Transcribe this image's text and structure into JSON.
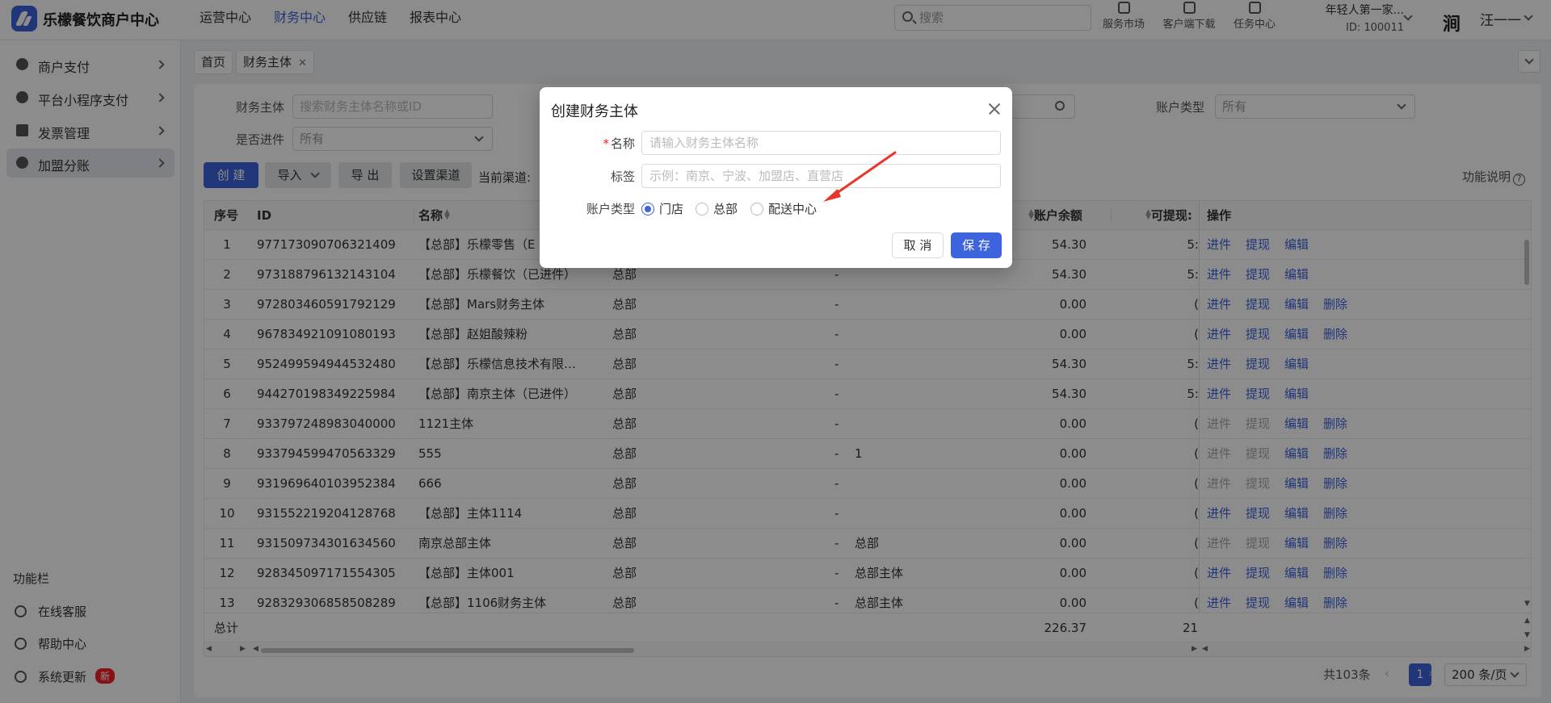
{
  "app": {
    "title": "乐檬餐饮商户中心"
  },
  "top_nav": [
    {
      "label": "运营中心",
      "active": false
    },
    {
      "label": "财务中心",
      "active": true
    },
    {
      "label": "供应链",
      "active": false
    },
    {
      "label": "报表中心",
      "active": false
    }
  ],
  "search": {
    "placeholder": "搜索"
  },
  "tools": [
    {
      "label": "服务市场",
      "icon": "store-icon"
    },
    {
      "label": "客户端下载",
      "icon": "download-icon"
    },
    {
      "label": "任务中心",
      "icon": "task-icon"
    }
  ],
  "tenant": {
    "name": "年轻人第一家...",
    "id": "ID: 100011"
  },
  "user": {
    "avatar_glyph": "涧",
    "name": "汪一一"
  },
  "sidebar": {
    "items": [
      {
        "label": "商户支付",
        "icon": "dollar-icon",
        "active": false
      },
      {
        "label": "平台小程序支付",
        "icon": "mini-program-icon",
        "active": false
      },
      {
        "label": "发票管理",
        "icon": "invoice-icon",
        "active": false
      },
      {
        "label": "加盟分账",
        "icon": "user-add-icon",
        "active": true
      }
    ],
    "func_title": "功能栏",
    "func_items": [
      {
        "label": "在线客服",
        "icon": "headset-icon"
      },
      {
        "label": "帮助中心",
        "icon": "help-icon"
      },
      {
        "label": "系统更新",
        "icon": "refresh-icon",
        "badge": "新"
      }
    ]
  },
  "tabs": [
    {
      "label": "首页",
      "closable": false
    },
    {
      "label": "财务主体",
      "closable": true
    }
  ],
  "filters": {
    "entity_label": "财务主体",
    "entity_placeholder": "搜索财务主体名称或ID",
    "account_type_label": "账户类型",
    "account_type_value": "所有",
    "incoming_label": "是否进件",
    "incoming_value": "所有"
  },
  "toolbar": {
    "create": "创 建",
    "import": "导入",
    "export": "导 出",
    "set_channel": "设置渠道",
    "current_channel": "当前渠道:",
    "help": "功能说明"
  },
  "table": {
    "headers": {
      "index": "序号",
      "id": "ID",
      "name": "名称",
      "balance": "账户余额",
      "withdrawable": "可提现:",
      "ops": "操作"
    },
    "rows": [
      {
        "idx": "1",
        "id": "977173090706321409",
        "name": "【总部】乐檬零售（E",
        "type": "",
        "dash": "",
        "tag": "",
        "balance": "54.30",
        "wd": "5:",
        "ops": [
          "进件",
          "提现",
          "编辑"
        ],
        "dis": [
          false,
          false,
          false
        ]
      },
      {
        "idx": "2",
        "id": "973188796132143104",
        "name": "【总部】乐檬餐饮（已进件）",
        "type": "总部",
        "dash": "-",
        "tag": "",
        "balance": "54.30",
        "wd": "5:",
        "ops": [
          "进件",
          "提现",
          "编辑"
        ],
        "dis": [
          false,
          false,
          false
        ]
      },
      {
        "idx": "3",
        "id": "972803460591792129",
        "name": "【总部】Mars财务主体",
        "type": "总部",
        "dash": "-",
        "tag": "",
        "balance": "0.00",
        "wd": "(",
        "ops": [
          "进件",
          "提现",
          "编辑",
          "删除"
        ],
        "dis": [
          false,
          false,
          false,
          false
        ]
      },
      {
        "idx": "4",
        "id": "967834921091080193",
        "name": "【总部】赵姐酸辣粉",
        "type": "总部",
        "dash": "-",
        "tag": "",
        "balance": "0.00",
        "wd": "(",
        "ops": [
          "进件",
          "提现",
          "编辑",
          "删除"
        ],
        "dis": [
          false,
          false,
          false,
          false
        ]
      },
      {
        "idx": "5",
        "id": "952499594944532480",
        "name": "【总部】乐檬信息技术有限…",
        "type": "总部",
        "dash": "-",
        "tag": "",
        "balance": "54.30",
        "wd": "5:",
        "ops": [
          "进件",
          "提现",
          "编辑"
        ],
        "dis": [
          false,
          false,
          false
        ]
      },
      {
        "idx": "6",
        "id": "944270198349225984",
        "name": "【总部】南京主体（已进件）",
        "type": "总部",
        "dash": "-",
        "tag": "",
        "balance": "54.30",
        "wd": "5:",
        "ops": [
          "进件",
          "提现",
          "编辑"
        ],
        "dis": [
          false,
          false,
          false
        ]
      },
      {
        "idx": "7",
        "id": "933797248983040000",
        "name": "1121主体",
        "type": "总部",
        "dash": "-",
        "tag": "",
        "balance": "0.00",
        "wd": "(",
        "ops": [
          "进件",
          "提现",
          "编辑",
          "删除"
        ],
        "dis": [
          true,
          true,
          false,
          false
        ]
      },
      {
        "idx": "8",
        "id": "933794599470563329",
        "name": "555",
        "type": "总部",
        "dash": "-",
        "tag": "1",
        "balance": "0.00",
        "wd": "(",
        "ops": [
          "进件",
          "提现",
          "编辑",
          "删除"
        ],
        "dis": [
          true,
          true,
          false,
          false
        ]
      },
      {
        "idx": "9",
        "id": "931969640103952384",
        "name": "666",
        "type": "总部",
        "dash": "-",
        "tag": "",
        "balance": "0.00",
        "wd": "(",
        "ops": [
          "进件",
          "提现",
          "编辑",
          "删除"
        ],
        "dis": [
          true,
          true,
          false,
          false
        ]
      },
      {
        "idx": "10",
        "id": "931552219204128768",
        "name": "【总部】主体1114",
        "type": "总部",
        "dash": "-",
        "tag": "",
        "balance": "0.00",
        "wd": "(",
        "ops": [
          "进件",
          "提现",
          "编辑",
          "删除"
        ],
        "dis": [
          false,
          false,
          false,
          false
        ]
      },
      {
        "idx": "11",
        "id": "931509734301634560",
        "name": "南京总部主体",
        "type": "总部",
        "dash": "-",
        "tag": "总部",
        "balance": "0.00",
        "wd": "(",
        "ops": [
          "进件",
          "提现",
          "编辑",
          "删除"
        ],
        "dis": [
          true,
          true,
          false,
          false
        ]
      },
      {
        "idx": "12",
        "id": "928345097171554305",
        "name": "【总部】主体001",
        "type": "总部",
        "dash": "-",
        "tag": "总部主体",
        "balance": "0.00",
        "wd": "(",
        "ops": [
          "进件",
          "提现",
          "编辑",
          "删除"
        ],
        "dis": [
          false,
          false,
          false,
          false
        ]
      },
      {
        "idx": "13",
        "id": "928329306858508289",
        "name": "【总部】1106财务主体",
        "type": "总部",
        "dash": "-",
        "tag": "总部主体",
        "balance": "0.00",
        "wd": "(",
        "ops": [
          "进件",
          "提现",
          "编辑",
          "删除"
        ],
        "dis": [
          false,
          false,
          false,
          false
        ]
      }
    ],
    "total_label": "总计",
    "total_balance": "226.37",
    "total_wd": "21:"
  },
  "pagination": {
    "total": "共103条",
    "current": "1",
    "page_size": "200 条/页"
  },
  "modal": {
    "title": "创建财务主体",
    "name_label": "名称",
    "name_placeholder": "请输入财务主体名称",
    "tag_label": "标签",
    "tag_placeholder": "示例：南京、宁波、加盟店、直营店",
    "account_type_label": "账户类型",
    "options": [
      {
        "label": "门店",
        "checked": true
      },
      {
        "label": "总部",
        "checked": false
      },
      {
        "label": "配送中心",
        "checked": false
      }
    ],
    "cancel": "取 消",
    "save": "保 存"
  },
  "colors": {
    "primary": "#3d63dd",
    "annotation_arrow": "#e8372a",
    "danger": "#f5222d"
  }
}
